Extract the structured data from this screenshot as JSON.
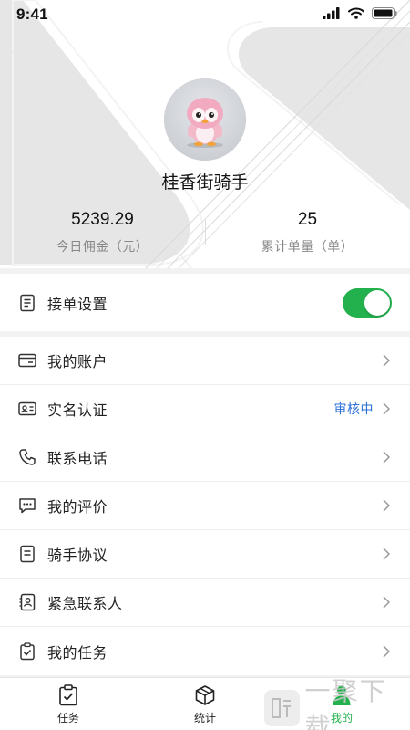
{
  "status_bar": {
    "time": "9:41"
  },
  "profile": {
    "name": "桂香街骑手",
    "stats": [
      {
        "value": "5239.29",
        "label": "今日佣金（元）"
      },
      {
        "value": "25",
        "label": "累计单量（单）"
      }
    ]
  },
  "settings": {
    "order_setting_label": "接单设置",
    "order_setting_enabled": true
  },
  "menu": [
    {
      "label": "我的账户",
      "icon": "wallet-icon"
    },
    {
      "label": "实名认证",
      "icon": "id-card-icon",
      "status": "审核中"
    },
    {
      "label": "联系电话",
      "icon": "phone-icon"
    },
    {
      "label": "我的评价",
      "icon": "comment-icon"
    },
    {
      "label": "骑手协议",
      "icon": "document-icon"
    },
    {
      "label": "紧急联系人",
      "icon": "contact-icon"
    },
    {
      "label": "我的任务",
      "icon": "clipboard-icon"
    }
  ],
  "tabbar": [
    {
      "label": "任务",
      "icon": "clipboard-check-icon",
      "active": false
    },
    {
      "label": "统计",
      "icon": "box-icon",
      "active": false
    },
    {
      "label": "我的",
      "icon": "person-icon",
      "active": true
    }
  ],
  "colors": {
    "accent": "#22b14c",
    "status_blue": "#2a6fd6"
  },
  "watermark": {
    "text": "一聚下载"
  }
}
